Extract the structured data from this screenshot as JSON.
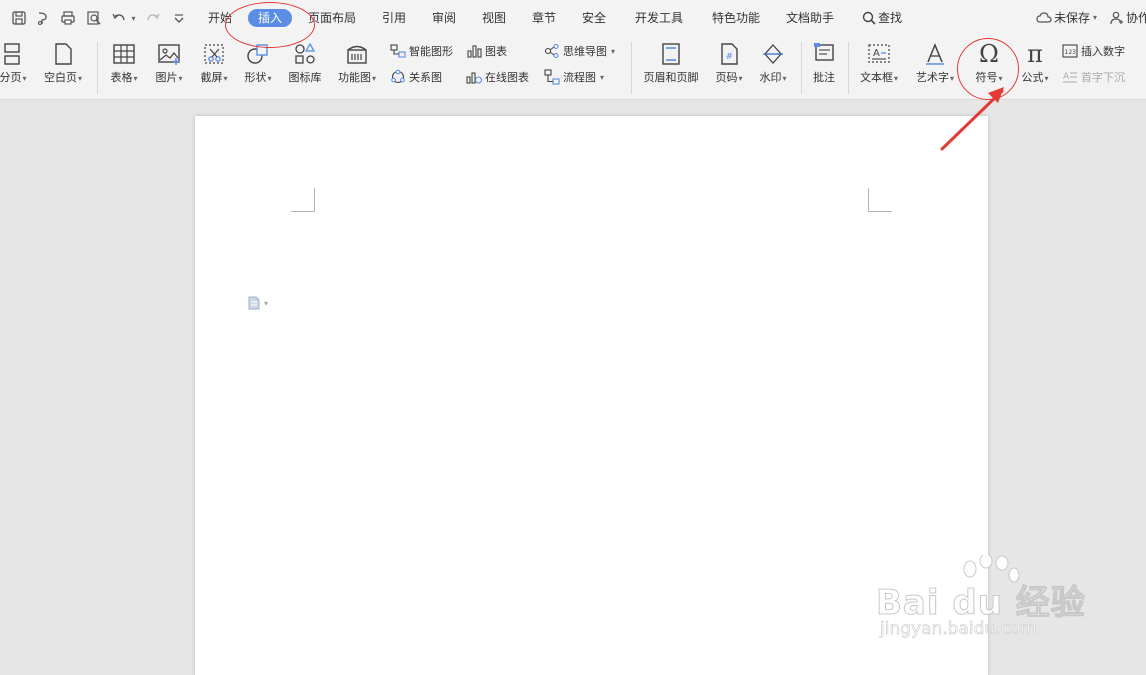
{
  "menubar": {
    "tabs": [
      "开始",
      "插入",
      "页面布局",
      "引用",
      "审阅",
      "视图",
      "章节",
      "安全",
      "开发工具",
      "特色功能",
      "文档助手"
    ],
    "active_tab": "插入",
    "search_label": "查找",
    "unsaved_label": "未保存",
    "collab_label": "协作"
  },
  "ribbon": {
    "page_break": "分页",
    "blank_page": "空白页",
    "table": "表格",
    "picture": "图片",
    "screenshot": "截屏",
    "shape": "形状",
    "icon_library": "图标库",
    "function_chart": "功能图",
    "smart_art": "智能图形",
    "relation_chart": "关系图",
    "chart": "图表",
    "online_chart": "在线图表",
    "mind_map": "思维导图",
    "flowchart": "流程图",
    "header_footer": "页眉和页脚",
    "page_number": "页码",
    "watermark": "水印",
    "comment": "批注",
    "text_box": "文本框",
    "word_art": "艺术字",
    "symbol": "符号",
    "formula": "公式",
    "insert_number": "插入数字",
    "drop_cap": "首字下沉",
    "symbol_glyph": "Ω",
    "formula_glyph": "π"
  },
  "watermark_overlay": {
    "logo_text": "Bai du 经验",
    "url_text": "jingyan.baidu.com"
  },
  "colors": {
    "active_tab_bg": "#5b8de6",
    "annotation_red": "#e53935",
    "toolbar_bg": "#f3f3f3",
    "canvas_bg": "#e6e6e6"
  }
}
